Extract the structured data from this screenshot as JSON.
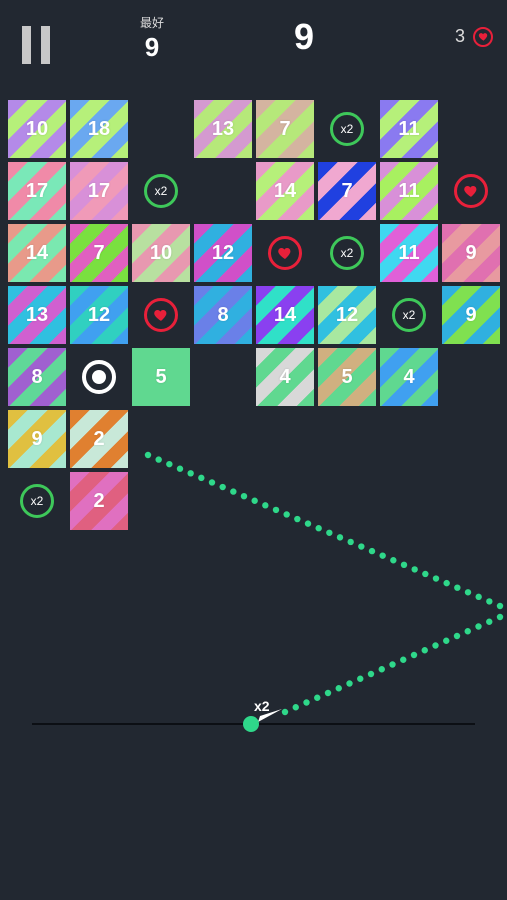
{
  "hud": {
    "best_label": "最好",
    "best_score": "9",
    "score": "9",
    "lives": "3"
  },
  "aim": {
    "multiplier": "x2"
  },
  "colors": {
    "background": "#222831",
    "x2_ring": "#3ec85a",
    "life_ring": "#e8203a",
    "aim_dots": "#2fd88a",
    "ball": "#2fd88a"
  },
  "grid": {
    "rows": [
      [
        {
          "kind": "block",
          "value": "10",
          "colors": [
            "#b48ae8",
            "#b6f07a"
          ]
        },
        {
          "kind": "block",
          "value": "18",
          "colors": [
            "#6aa8f0",
            "#b6f07a"
          ]
        },
        {
          "kind": "empty"
        },
        {
          "kind": "block",
          "value": "13",
          "colors": [
            "#d49ad0",
            "#b6e87a"
          ]
        },
        {
          "kind": "block",
          "value": "7",
          "colors": [
            "#d4b4a0",
            "#b6e87a"
          ]
        },
        {
          "kind": "x2",
          "label": "x2"
        },
        {
          "kind": "block",
          "value": "11",
          "colors": [
            "#8a7af0",
            "#b6f07a"
          ]
        },
        {
          "kind": "empty"
        }
      ],
      [
        {
          "kind": "block",
          "value": "17",
          "colors": [
            "#f08aa8",
            "#7ae8b8"
          ]
        },
        {
          "kind": "block",
          "value": "17",
          "colors": [
            "#d890d8",
            "#f09ab8"
          ]
        },
        {
          "kind": "x2",
          "label": "x2"
        },
        {
          "kind": "empty"
        },
        {
          "kind": "block",
          "value": "14",
          "colors": [
            "#e89ac8",
            "#b6f07a"
          ]
        },
        {
          "kind": "block",
          "value": "7",
          "colors": [
            "#2040e0",
            "#f0a8d0"
          ]
        },
        {
          "kind": "block",
          "value": "11",
          "colors": [
            "#d890d8",
            "#a8f060"
          ]
        },
        {
          "kind": "life"
        }
      ],
      [
        {
          "kind": "block",
          "value": "14",
          "colors": [
            "#e89a8a",
            "#7ae8b0"
          ]
        },
        {
          "kind": "block",
          "value": "7",
          "colors": [
            "#e060c0",
            "#7ae040"
          ]
        },
        {
          "kind": "block",
          "value": "10",
          "colors": [
            "#e898b0",
            "#b8e0a0"
          ]
        },
        {
          "kind": "block",
          "value": "12",
          "colors": [
            "#d050c8",
            "#30b0e0"
          ]
        },
        {
          "kind": "life"
        },
        {
          "kind": "x2",
          "label": "x2"
        },
        {
          "kind": "block",
          "value": "11",
          "colors": [
            "#40d8f0",
            "#e060d8"
          ]
        },
        {
          "kind": "block",
          "value": "9",
          "colors": [
            "#e070b0",
            "#e89aa0"
          ]
        }
      ],
      [
        {
          "kind": "block",
          "value": "13",
          "colors": [
            "#30c0e0",
            "#d060d0"
          ]
        },
        {
          "kind": "block",
          "value": "12",
          "colors": [
            "#30d0c0",
            "#40a0f0"
          ]
        },
        {
          "kind": "life"
        },
        {
          "kind": "block",
          "value": "8",
          "colors": [
            "#6a80e8",
            "#30b0e0"
          ]
        },
        {
          "kind": "block",
          "value": "14",
          "colors": [
            "#8a40f0",
            "#30e0c8"
          ]
        },
        {
          "kind": "block",
          "value": "12",
          "colors": [
            "#30c0e0",
            "#a8e8a0"
          ]
        },
        {
          "kind": "x2",
          "label": "x2"
        },
        {
          "kind": "block",
          "value": "9",
          "colors": [
            "#30b0e0",
            "#80e050"
          ]
        }
      ],
      [
        {
          "kind": "block",
          "value": "8",
          "colors": [
            "#a060d0",
            "#60d898"
          ]
        },
        {
          "kind": "target"
        },
        {
          "kind": "block",
          "value": "5",
          "colors": [
            "#60d890",
            "#60d890"
          ]
        },
        {
          "kind": "empty"
        },
        {
          "kind": "block",
          "value": "4",
          "colors": [
            "#d8d8d8",
            "#60d890"
          ]
        },
        {
          "kind": "block",
          "value": "5",
          "colors": [
            "#d0b080",
            "#60d890"
          ]
        },
        {
          "kind": "block",
          "value": "4",
          "colors": [
            "#60d890",
            "#40a0f0"
          ]
        },
        {
          "kind": "empty"
        }
      ],
      [
        {
          "kind": "block",
          "value": "9",
          "colors": [
            "#e0c040",
            "#a8e8d0"
          ]
        },
        {
          "kind": "block",
          "value": "2",
          "colors": [
            "#e08030",
            "#c8e8d8"
          ]
        },
        {
          "kind": "empty"
        },
        {
          "kind": "empty"
        },
        {
          "kind": "empty"
        },
        {
          "kind": "empty"
        },
        {
          "kind": "empty"
        },
        {
          "kind": "empty"
        }
      ],
      [
        {
          "kind": "x2",
          "label": "x2"
        },
        {
          "kind": "block",
          "value": "2",
          "colors": [
            "#e070c0",
            "#e06080"
          ]
        },
        {
          "kind": "empty"
        },
        {
          "kind": "empty"
        },
        {
          "kind": "empty"
        },
        {
          "kind": "empty"
        },
        {
          "kind": "empty"
        },
        {
          "kind": "empty"
        }
      ]
    ]
  }
}
